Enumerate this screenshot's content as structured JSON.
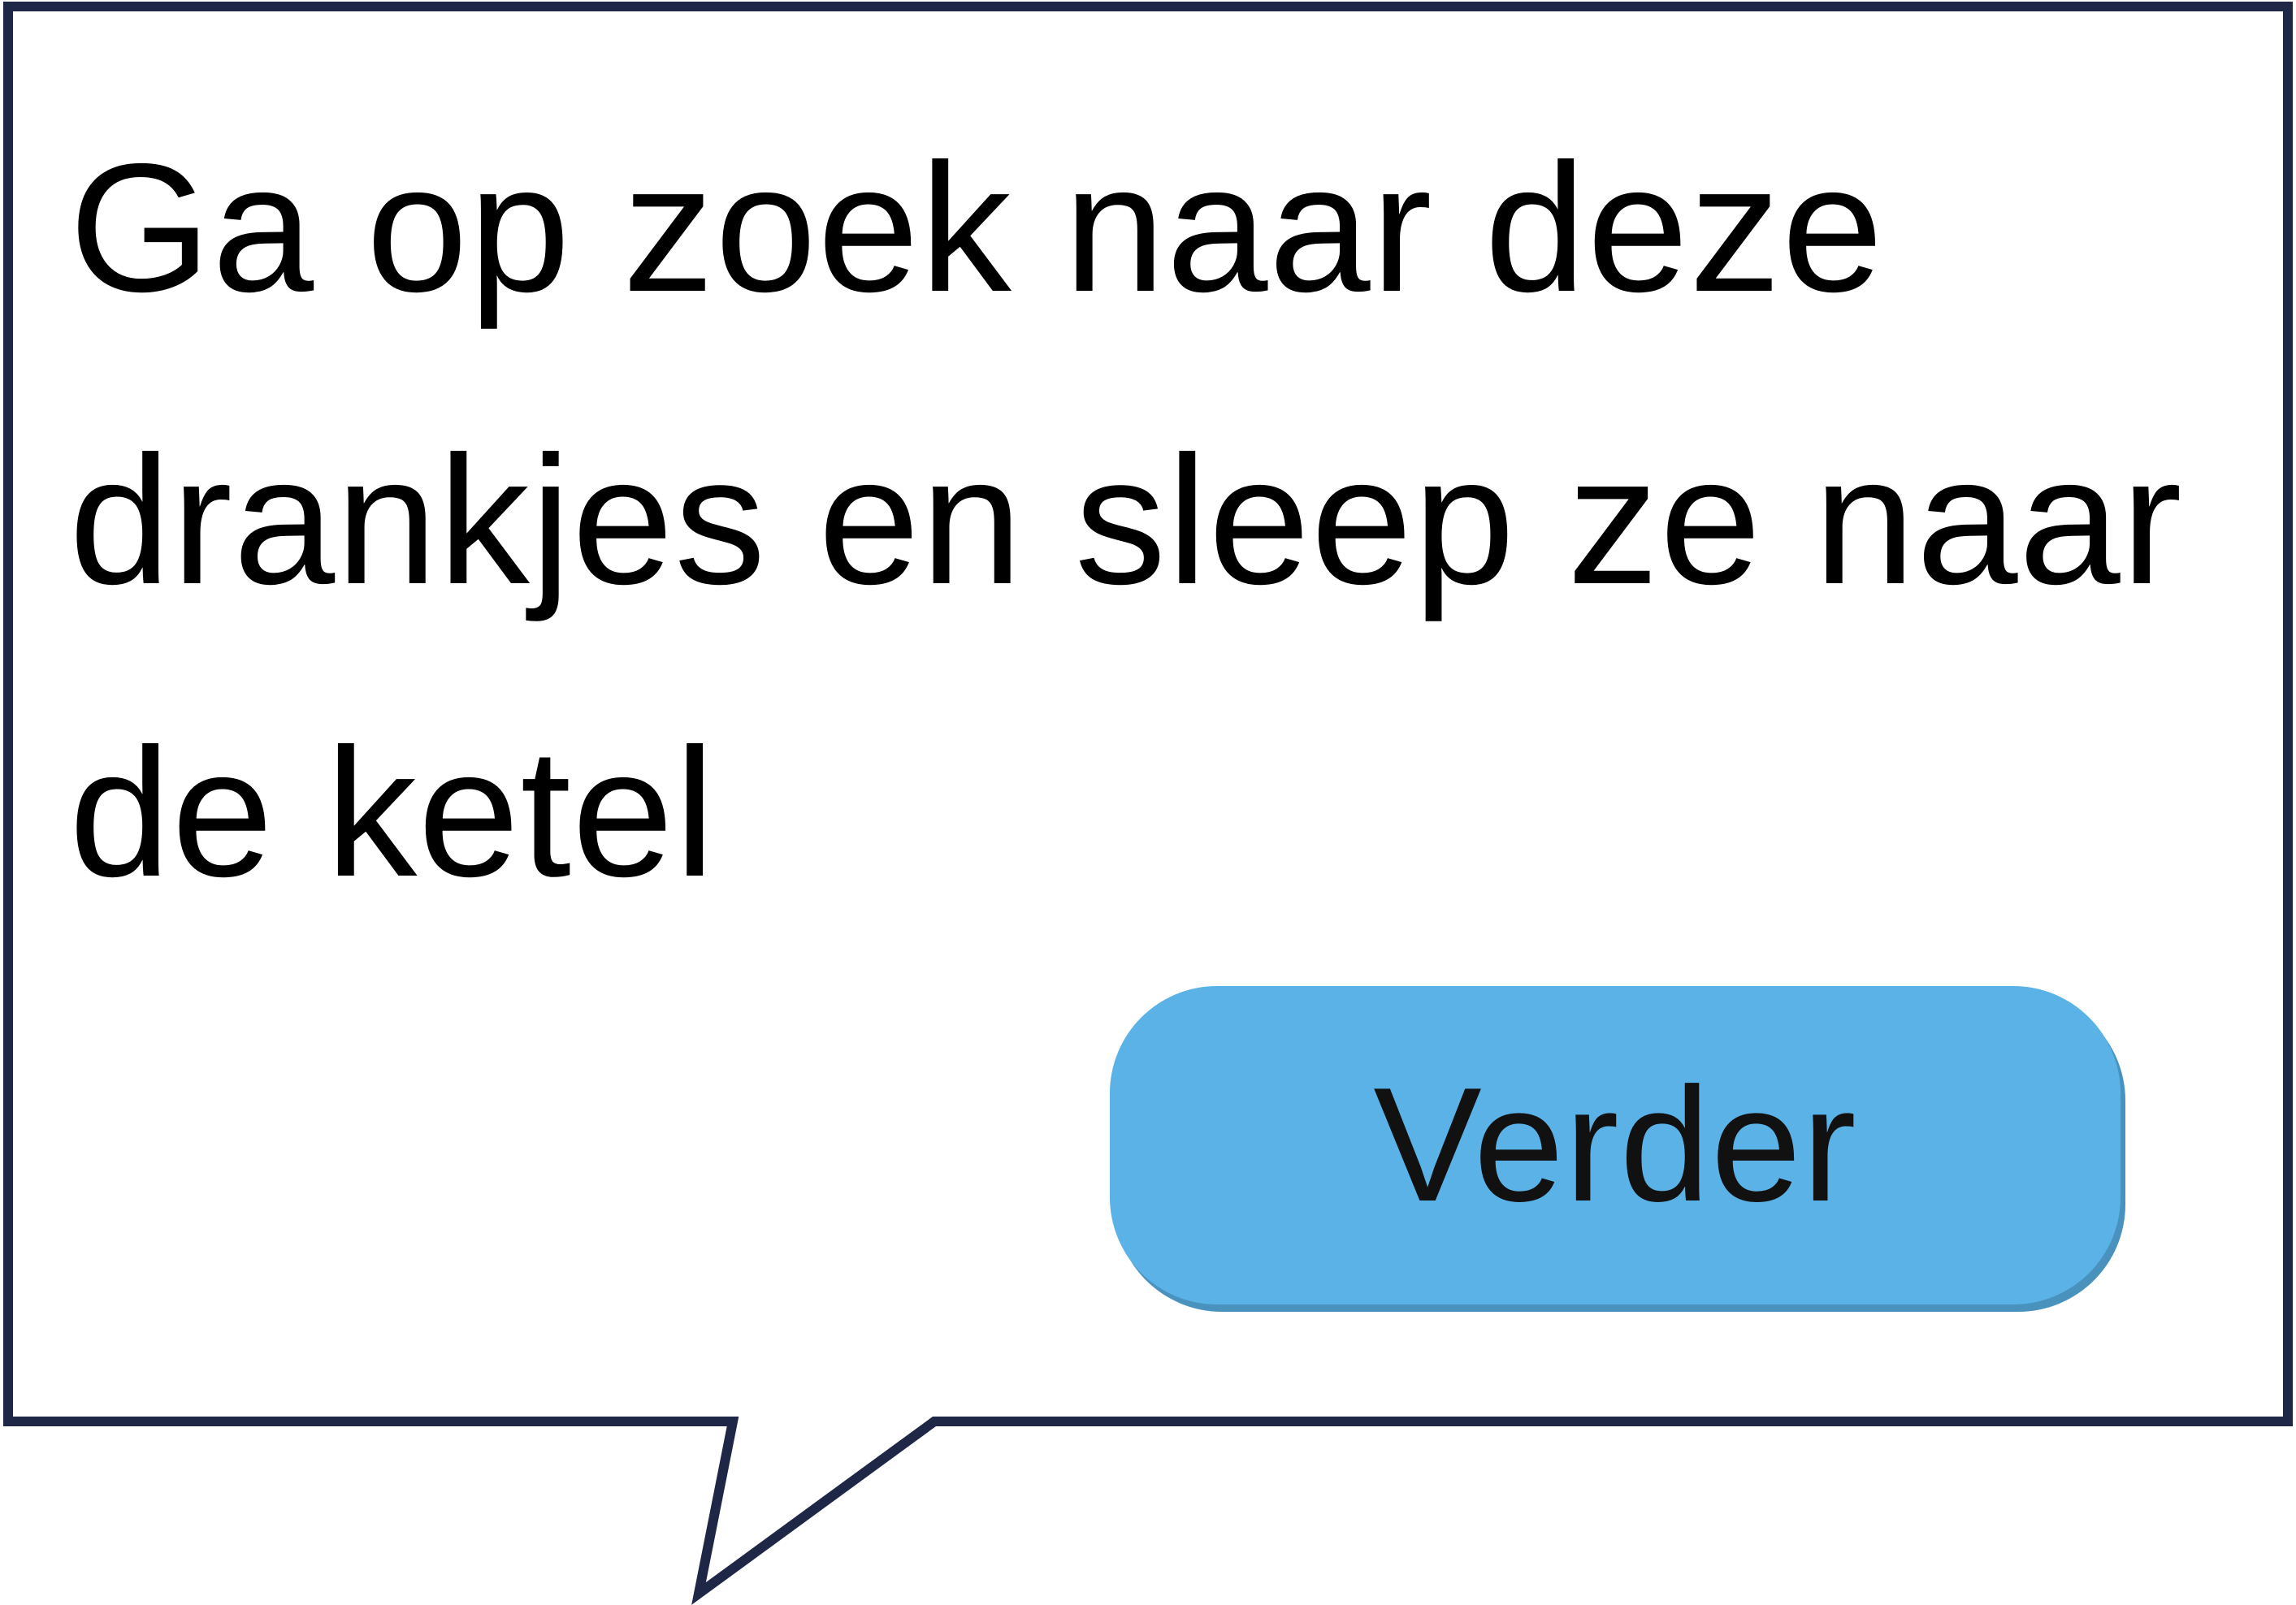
{
  "dialog": {
    "message": "Ga op zoek naar deze drankjes en sleep ze naar de ketel",
    "continue_label": "Verder"
  },
  "colors": {
    "bubble_border": "#1e2846",
    "bubble_fill": "#ffffff",
    "button_fill": "#5ab2e6",
    "button_shadow": "#4a92be",
    "text": "#000000"
  }
}
